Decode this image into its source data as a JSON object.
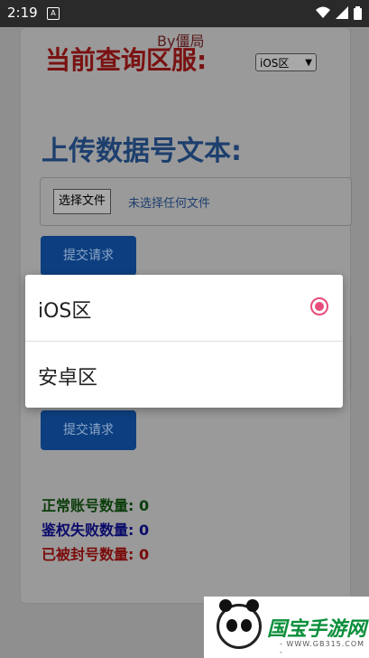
{
  "statusbar": {
    "time": "2:19",
    "notif_glyph": "A",
    "icons": [
      "wifi-icon",
      "signal-icon",
      "battery-icon"
    ]
  },
  "page": {
    "by_label": "By僵局",
    "region_title": "当前查询区服:",
    "region_select_value": "iOS区",
    "upload_title": "上传数据号文本:",
    "file_button": "选择文件",
    "file_status": "未选择任何文件",
    "submit1": "提交请求",
    "submit2": "提交请求",
    "stats": [
      {
        "label": "正常账号数量: 0",
        "color": "#0b3d0b"
      },
      {
        "label": "鉴权失败数量: 0",
        "color": "#0a0a6a"
      },
      {
        "label": "已被封号数量: 0",
        "color": "#7a0a0a"
      }
    ]
  },
  "dialog": {
    "options": [
      {
        "label": "iOS区",
        "selected": true
      },
      {
        "label": "安卓区",
        "selected": false
      }
    ],
    "accent": "#e84c7a"
  },
  "watermark": {
    "text": "国宝手游网",
    "url": "- WWW.GB315.COM -"
  }
}
